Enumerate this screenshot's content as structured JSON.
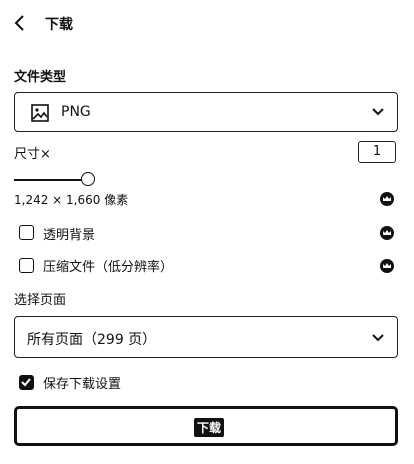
{
  "header": {
    "title": "下载",
    "back_icon": "chevron-left-icon"
  },
  "file_type": {
    "label": "文件类型",
    "selected": "PNG",
    "icon": "image-icon",
    "dropdown_icon": "chevron-down-icon"
  },
  "size": {
    "label": "尺寸×",
    "multiplier_value": "1",
    "slider_value": 1,
    "dimensions": "1,242 × 1,660 像素",
    "premium_icon": "crown-icon"
  },
  "options": [
    {
      "label": "透明背景",
      "checked": false,
      "premium_icon": "crown-icon"
    },
    {
      "label": "压缩文件（低分辨率）",
      "checked": false,
      "premium_icon": "crown-icon"
    }
  ],
  "pages": {
    "label": "选择页面",
    "selected": "所有页面（299 页）",
    "dropdown_icon": "chevron-down-icon"
  },
  "save_settings": {
    "label": "保存下载设置",
    "checked": true
  },
  "download_button": {
    "label": "下载"
  }
}
